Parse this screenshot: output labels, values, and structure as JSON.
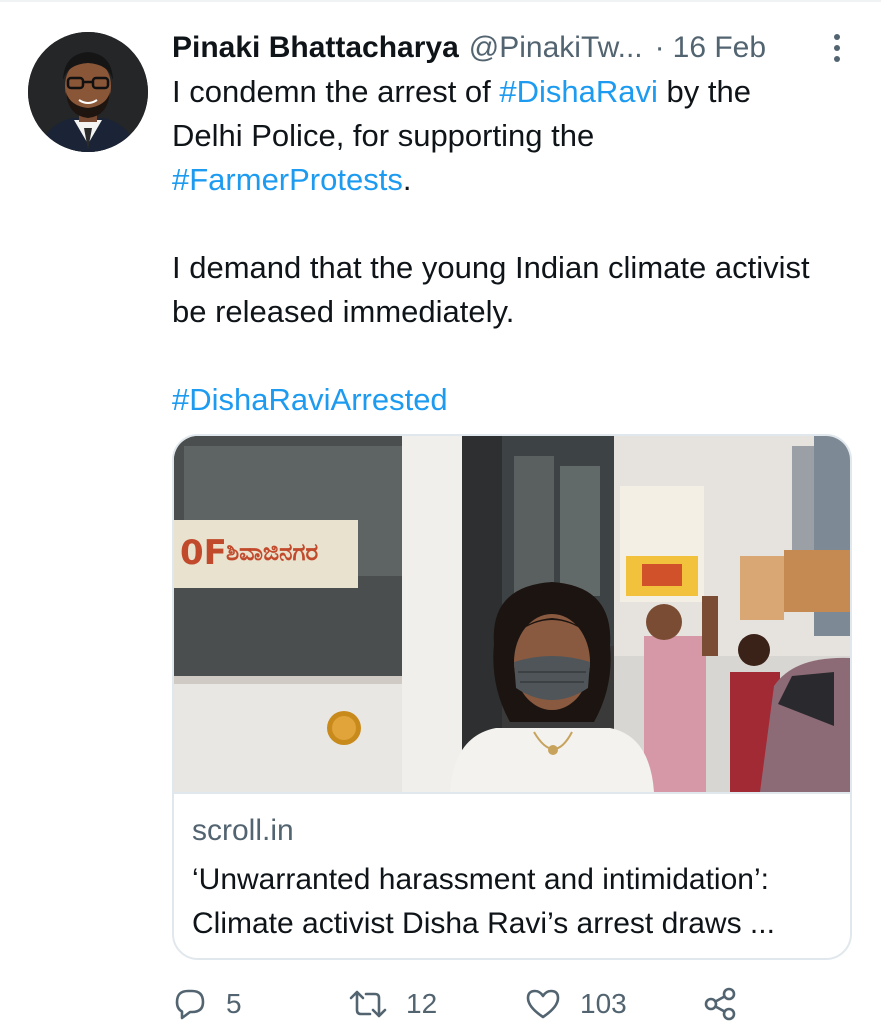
{
  "tweet": {
    "author": {
      "name": "Pinaki Bhattacharya",
      "handle": "@PinakiTw...",
      "separator": "·",
      "date": "16 Feb"
    },
    "body": {
      "p1_prefix": "I condemn the arrest of ",
      "p1_hashtag_1": "#DishaRavi",
      "p1_middle": " by the Delhi Police, for supporting the ",
      "p1_hashtag_2": "#FarmerProtests",
      "p1_suffix": ".",
      "p2": "I demand that the young Indian climate activist be released immediately.",
      "p3_hashtag": "#DishaRaviArrested"
    },
    "card": {
      "domain": "scroll.in",
      "title": "‘Unwarranted harassment and intimidation’: Climate activist Disha Ravi’s arrest draws ..."
    },
    "actions": {
      "replies": "5",
      "retweets": "12",
      "likes": "103"
    },
    "icons": {
      "more": "more-vertical-icon",
      "reply": "reply-icon",
      "retweet": "retweet-icon",
      "like": "heart-icon",
      "share": "share-icon"
    },
    "colors": {
      "link": "#1d9bf0",
      "muted": "#536471",
      "text": "#0f1419",
      "border": "#e1e8ed"
    }
  }
}
